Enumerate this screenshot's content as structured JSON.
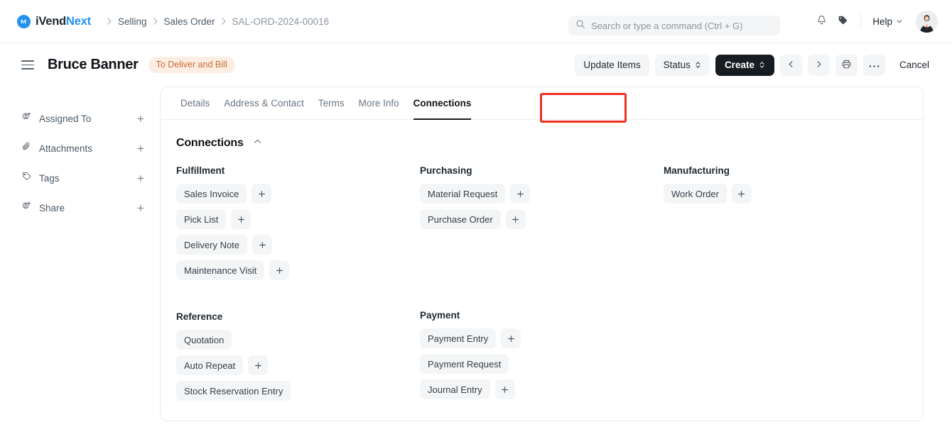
{
  "navbar": {
    "brand": {
      "first": "iVend",
      "second": "Next",
      "mark_icon": "ivend-logo-icon"
    },
    "breadcrumbs": [
      {
        "label": "Selling",
        "muted": false
      },
      {
        "label": "Sales Order",
        "muted": false
      },
      {
        "label": "SAL-ORD-2024-00016",
        "muted": true
      }
    ],
    "search": {
      "placeholder": "Search or type a command (Ctrl + G)",
      "value": "",
      "icon": "search-icon"
    },
    "notifications_icon": "bell-icon",
    "tags_icon": "tag-icon",
    "help_label": "Help",
    "help_chevron_icon": "chevron-down-icon",
    "avatar_icon": "user-avatar"
  },
  "pagehead": {
    "menu_icon": "hamburger-menu-icon",
    "title": "Bruce Banner",
    "status": "To Deliver and Bill",
    "actions": {
      "update_items": "Update Items",
      "status": "Status",
      "create": "Create",
      "prev_icon": "chevron-left-icon",
      "next_icon": "chevron-right-icon",
      "print_icon": "printer-icon",
      "more_icon": "ellipsis-icon",
      "cancel": "Cancel"
    },
    "highlight_color": "#ef3124"
  },
  "sidebar": {
    "items": [
      {
        "label": "Assigned To",
        "icon": "user-plus-icon",
        "add": "+"
      },
      {
        "label": "Attachments",
        "icon": "paperclip-icon",
        "add": "+"
      },
      {
        "label": "Tags",
        "icon": "tag-outline-icon",
        "add": "+"
      },
      {
        "label": "Share",
        "icon": "user-plus-icon",
        "add": "+"
      }
    ]
  },
  "main": {
    "tabs": [
      {
        "label": "Details",
        "active": false
      },
      {
        "label": "Address & Contact",
        "active": false
      },
      {
        "label": "Terms",
        "active": false
      },
      {
        "label": "More Info",
        "active": false
      },
      {
        "label": "Connections",
        "active": true
      }
    ],
    "section": {
      "title": "Connections",
      "collapse_icon": "chevron-up-icon"
    },
    "columns": [
      {
        "groups": [
          {
            "title": "Fulfillment",
            "links": [
              {
                "label": "Sales Invoice",
                "add": true
              },
              {
                "label": "Pick List",
                "add": true
              },
              {
                "label": "Delivery Note",
                "add": true
              },
              {
                "label": "Maintenance Visit",
                "add": true
              }
            ]
          },
          {
            "title": "Reference",
            "links": [
              {
                "label": "Quotation",
                "add": false
              },
              {
                "label": "Auto Repeat",
                "add": true
              },
              {
                "label": "Stock Reservation Entry",
                "add": false
              }
            ]
          }
        ]
      },
      {
        "groups": [
          {
            "title": "Purchasing",
            "links": [
              {
                "label": "Material Request",
                "add": true
              },
              {
                "label": "Purchase Order",
                "add": true
              }
            ]
          },
          {
            "title": "Payment",
            "links": [
              {
                "label": "Payment Entry",
                "add": true
              },
              {
                "label": "Payment Request",
                "add": false
              },
              {
                "label": "Journal Entry",
                "add": true
              }
            ]
          }
        ]
      },
      {
        "groups": [
          {
            "title": "Manufacturing",
            "links": [
              {
                "label": "Work Order",
                "add": true
              }
            ]
          }
        ]
      }
    ]
  }
}
